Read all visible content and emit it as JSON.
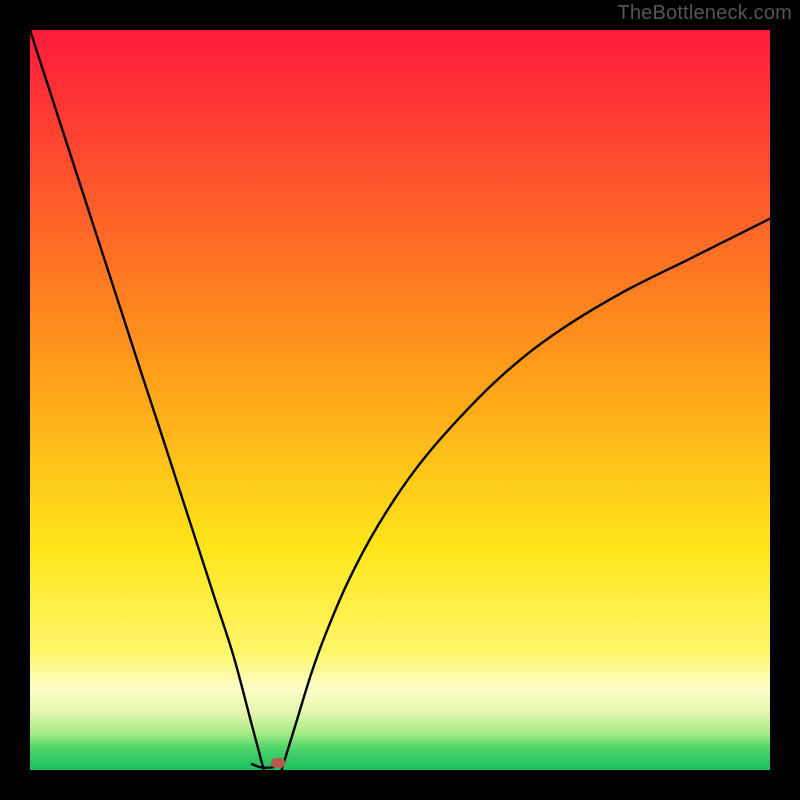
{
  "watermark": "TheBottleneck.com",
  "colors": {
    "frame_bg": "#000000",
    "watermark": "#555555",
    "curve": "#000000",
    "marker": "#b35a4a",
    "gradient_stops": [
      {
        "offset": 0.0,
        "color": "#ff1a3c"
      },
      {
        "offset": 0.45,
        "color": "#ff9a1a"
      },
      {
        "offset": 0.7,
        "color": "#ffe51a"
      },
      {
        "offset": 0.84,
        "color": "#fff66a"
      },
      {
        "offset": 0.89,
        "color": "#fdfdc8"
      },
      {
        "offset": 0.92,
        "color": "#e7f7b0"
      },
      {
        "offset": 0.95,
        "color": "#a7eb85"
      },
      {
        "offset": 0.97,
        "color": "#4fd66a"
      },
      {
        "offset": 1.0,
        "color": "#18c060"
      }
    ]
  },
  "chart_data": {
    "type": "line",
    "title": "",
    "xlabel": "",
    "ylabel": "",
    "xlim": [
      0,
      1
    ],
    "ylim": [
      0,
      1
    ],
    "grid": false,
    "legend": false,
    "series": [
      {
        "name": "left-branch",
        "x": [
          0.0,
          0.025,
          0.05,
          0.075,
          0.1,
          0.125,
          0.15,
          0.175,
          0.2,
          0.225,
          0.25,
          0.275,
          0.3,
          0.316
        ],
        "y": [
          1.0,
          0.923,
          0.846,
          0.769,
          0.692,
          0.615,
          0.538,
          0.462,
          0.385,
          0.308,
          0.231,
          0.154,
          0.06,
          0.0
        ]
      },
      {
        "name": "right-branch",
        "x": [
          0.34,
          0.36,
          0.38,
          0.4,
          0.43,
          0.47,
          0.52,
          0.575,
          0.64,
          0.71,
          0.8,
          0.89,
          0.95,
          1.0
        ],
        "y": [
          0.0,
          0.065,
          0.13,
          0.185,
          0.255,
          0.33,
          0.405,
          0.47,
          0.535,
          0.59,
          0.645,
          0.69,
          0.72,
          0.745
        ]
      },
      {
        "name": "valley-floor",
        "x": [
          0.3,
          0.31,
          0.32,
          0.33,
          0.34
        ],
        "y": [
          0.008,
          0.004,
          0.003,
          0.004,
          0.008
        ]
      }
    ],
    "annotations": [
      {
        "name": "marker-dot",
        "x": 0.335,
        "y": 0.01
      }
    ]
  }
}
